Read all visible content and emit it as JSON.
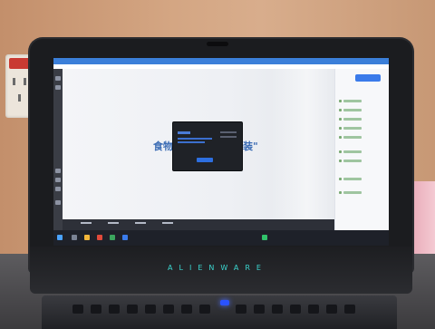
{
  "brand": "ALIENWARE",
  "screen": {
    "window_title": "",
    "headline_left": "食物",
    "headline_right": "装\"",
    "dialog": {
      "confirm_label": ""
    },
    "right_panel": {
      "primary_button_label": ""
    },
    "taskbar": {
      "clock": ""
    }
  },
  "colors": {
    "alienware_cyan": "#3bd6d0",
    "app_blue": "#3b7fd9",
    "dialog_dark": "#1f2227"
  }
}
